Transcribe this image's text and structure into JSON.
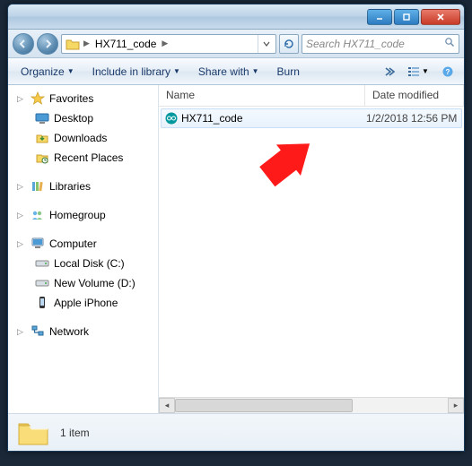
{
  "address": {
    "path": "HX711_code"
  },
  "search": {
    "placeholder": "Search HX711_code"
  },
  "toolbar": {
    "organize": "Organize",
    "include": "Include in library",
    "share": "Share with",
    "burn": "Burn"
  },
  "columns": {
    "name": "Name",
    "date": "Date modified"
  },
  "nav": {
    "favorites": {
      "label": "Favorites",
      "items": [
        "Desktop",
        "Downloads",
        "Recent Places"
      ]
    },
    "libraries": {
      "label": "Libraries"
    },
    "homegroup": {
      "label": "Homegroup"
    },
    "computer": {
      "label": "Computer",
      "items": [
        "Local Disk (C:)",
        "New Volume (D:)",
        "Apple iPhone"
      ]
    },
    "network": {
      "label": "Network"
    }
  },
  "files": [
    {
      "name": "HX711_code",
      "date": "1/2/2018 12:56 PM"
    }
  ],
  "status": {
    "count": "1 item"
  }
}
